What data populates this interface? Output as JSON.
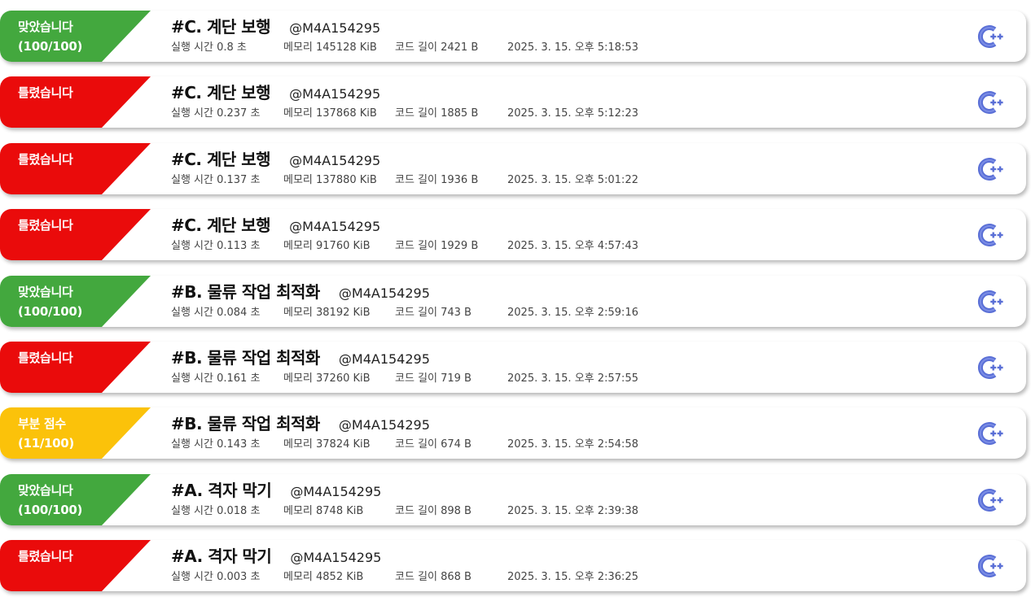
{
  "icons": {
    "language": "cpp-icon"
  },
  "colors": {
    "accepted": "#43a83e",
    "wrong": "#ea0b0b",
    "partial": "#fbc20a",
    "lang_icon": "#5a6fd6"
  },
  "submissions": [
    {
      "status": "ok",
      "line1": "맞았습니다",
      "line2": "(100/100)",
      "problem": "#C. 계단 보행",
      "user": "@M4A154295",
      "time": "실행 시간 0.8 초",
      "memory": "메모리 145128 KiB",
      "code_length": "코드 길이 2421 B",
      "date": "2025. 3. 15. 오후 5:18:53"
    },
    {
      "status": "wrong",
      "line1": "틀렸습니다",
      "line2": "",
      "problem": "#C. 계단 보행",
      "user": "@M4A154295",
      "time": "실행 시간 0.237 초",
      "memory": "메모리 137868 KiB",
      "code_length": "코드 길이 1885 B",
      "date": "2025. 3. 15. 오후 5:12:23"
    },
    {
      "status": "wrong",
      "line1": "틀렸습니다",
      "line2": "",
      "problem": "#C. 계단 보행",
      "user": "@M4A154295",
      "time": "실행 시간 0.137 초",
      "memory": "메모리 137880 KiB",
      "code_length": "코드 길이 1936 B",
      "date": "2025. 3. 15. 오후 5:01:22"
    },
    {
      "status": "wrong",
      "line1": "틀렸습니다",
      "line2": "",
      "problem": "#C. 계단 보행",
      "user": "@M4A154295",
      "time": "실행 시간 0.113 초",
      "memory": "메모리 91760 KiB",
      "code_length": "코드 길이 1929 B",
      "date": "2025. 3. 15. 오후 4:57:43"
    },
    {
      "status": "ok",
      "line1": "맞았습니다",
      "line2": "(100/100)",
      "problem": "#B. 물류 작업 최적화",
      "user": "@M4A154295",
      "time": "실행 시간 0.084 초",
      "memory": "메모리 38192 KiB",
      "code_length": "코드 길이 743 B",
      "date": "2025. 3. 15. 오후 2:59:16"
    },
    {
      "status": "wrong",
      "line1": "틀렸습니다",
      "line2": "",
      "problem": "#B. 물류 작업 최적화",
      "user": "@M4A154295",
      "time": "실행 시간 0.161 초",
      "memory": "메모리 37260 KiB",
      "code_length": "코드 길이 719 B",
      "date": "2025. 3. 15. 오후 2:57:55"
    },
    {
      "status": "partial",
      "line1": "부분 점수",
      "line2": "(11/100)",
      "problem": "#B. 물류 작업 최적화",
      "user": "@M4A154295",
      "time": "실행 시간 0.143 초",
      "memory": "메모리 37824 KiB",
      "code_length": "코드 길이 674 B",
      "date": "2025. 3. 15. 오후 2:54:58"
    },
    {
      "status": "ok",
      "line1": "맞았습니다",
      "line2": "(100/100)",
      "problem": "#A. 격자 막기",
      "user": "@M4A154295",
      "time": "실행 시간 0.018 초",
      "memory": "메모리 8748 KiB",
      "code_length": "코드 길이 898 B",
      "date": "2025. 3. 15. 오후 2:39:38"
    },
    {
      "status": "wrong",
      "line1": "틀렸습니다",
      "line2": "",
      "problem": "#A. 격자 막기",
      "user": "@M4A154295",
      "time": "실행 시간 0.003 초",
      "memory": "메모리 4852 KiB",
      "code_length": "코드 길이 868 B",
      "date": "2025. 3. 15. 오후 2:36:25"
    }
  ]
}
